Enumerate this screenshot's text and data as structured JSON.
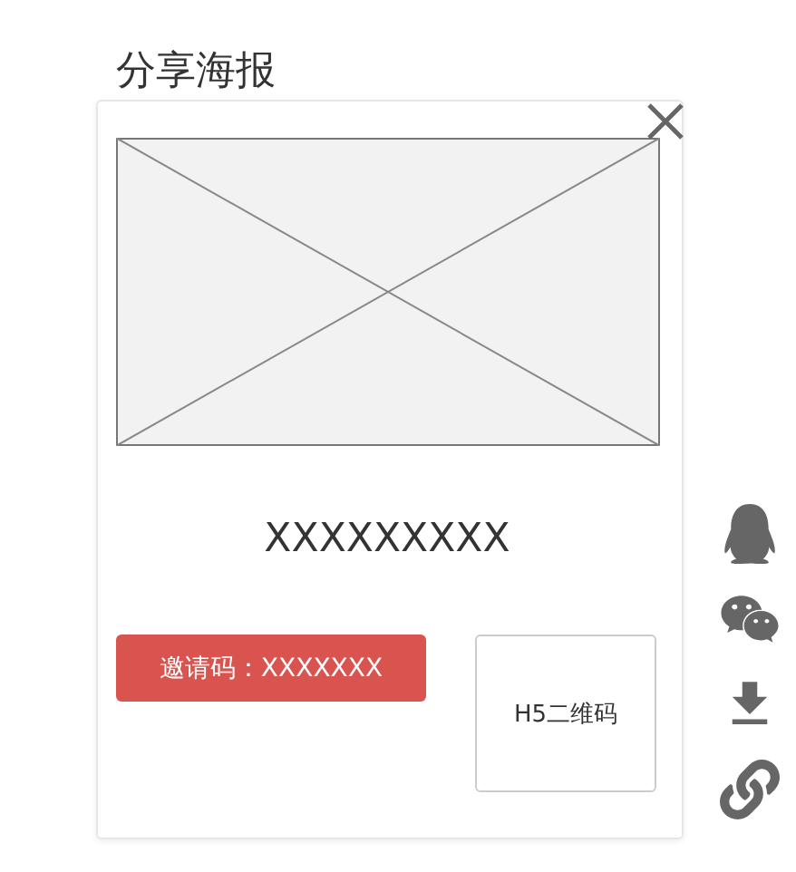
{
  "title": "分享海报",
  "poster": {
    "name": "XXXXXXXXX",
    "invite_code": "邀请码：XXXXXXX",
    "qr_code": "H5二维码"
  },
  "share_options": [
    {
      "kind": "qq"
    },
    {
      "kind": "wechat"
    },
    {
      "kind": "download"
    },
    {
      "kind": "link"
    }
  ]
}
